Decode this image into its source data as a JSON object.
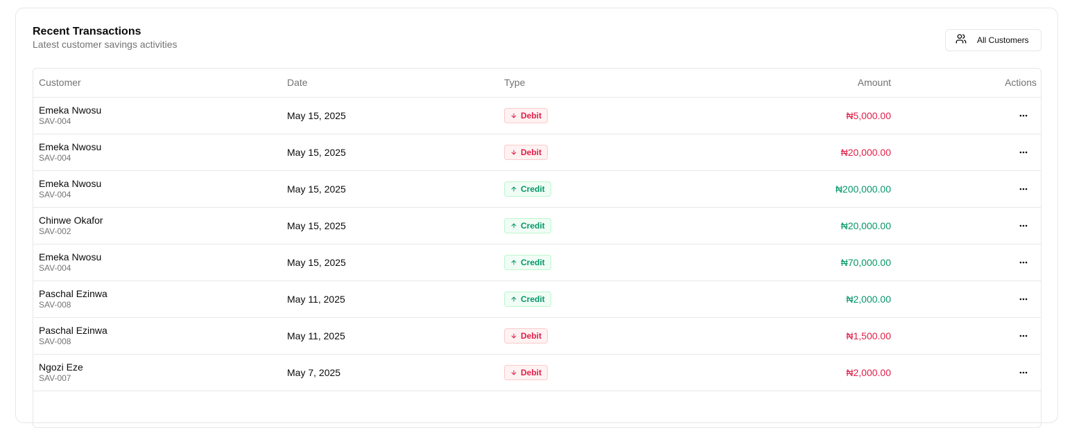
{
  "card": {
    "title": "Recent Transactions",
    "subtitle": "Latest customer savings activities",
    "filter_label": "All Customers",
    "filter_icon": "users-icon"
  },
  "table": {
    "headers": {
      "customer": "Customer",
      "date": "Date",
      "type": "Type",
      "amount": "Amount",
      "actions": "Actions"
    },
    "rows": [
      {
        "name": "Emeka Nwosu",
        "id": "SAV-004",
        "date": "May 15, 2025",
        "type": "Debit",
        "amount": "₦5,000.00"
      },
      {
        "name": "Emeka Nwosu",
        "id": "SAV-004",
        "date": "May 15, 2025",
        "type": "Debit",
        "amount": "₦20,000.00"
      },
      {
        "name": "Emeka Nwosu",
        "id": "SAV-004",
        "date": "May 15, 2025",
        "type": "Credit",
        "amount": "₦200,000.00"
      },
      {
        "name": "Chinwe Okafor",
        "id": "SAV-002",
        "date": "May 15, 2025",
        "type": "Credit",
        "amount": "₦20,000.00"
      },
      {
        "name": "Emeka Nwosu",
        "id": "SAV-004",
        "date": "May 15, 2025",
        "type": "Credit",
        "amount": "₦70,000.00"
      },
      {
        "name": "Paschal Ezinwa",
        "id": "SAV-008",
        "date": "May 11, 2025",
        "type": "Credit",
        "amount": "₦2,000.00"
      },
      {
        "name": "Paschal Ezinwa",
        "id": "SAV-008",
        "date": "May 11, 2025",
        "type": "Debit",
        "amount": "₦1,500.00"
      },
      {
        "name": "Ngozi Eze",
        "id": "SAV-007",
        "date": "May 7, 2025",
        "type": "Debit",
        "amount": "₦2,000.00"
      }
    ]
  },
  "colors": {
    "debit": "#e11d48",
    "credit": "#059669",
    "border": "#e5e7eb",
    "muted_text": "#737373"
  },
  "icons": {
    "debit": "arrow-down-icon",
    "credit": "arrow-up-icon",
    "actions": "more-horizontal-icon"
  }
}
